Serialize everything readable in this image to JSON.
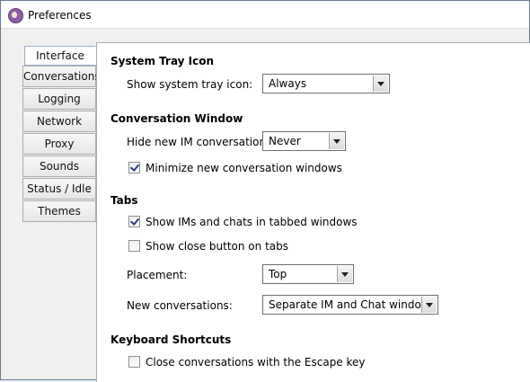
{
  "window": {
    "title": "Preferences"
  },
  "tabs": [
    {
      "label": "Interface",
      "active": true
    },
    {
      "label": "Conversations",
      "active": false
    },
    {
      "label": "Logging",
      "active": false
    },
    {
      "label": "Network",
      "active": false
    },
    {
      "label": "Proxy",
      "active": false
    },
    {
      "label": "Sounds",
      "active": false
    },
    {
      "label": "Status / Idle",
      "active": false
    },
    {
      "label": "Themes",
      "active": false
    }
  ],
  "sections": {
    "tray": {
      "title": "System Tray Icon",
      "show_label": "Show system tray icon:",
      "show_value": "Always"
    },
    "conversation": {
      "title": "Conversation Window",
      "hide_label": "Hide new IM conversations:",
      "hide_value": "Never",
      "minimize_label": "Minimize new conversation windows",
      "minimize_checked": true
    },
    "tabs": {
      "title": "Tabs",
      "tabbed_label": "Show IMs and chats in tabbed windows",
      "tabbed_checked": true,
      "close_label": "Show close button on tabs",
      "close_checked": false,
      "placement_label": "Placement:",
      "placement_value": "Top",
      "newconv_label": "New conversations:",
      "newconv_value": "Separate IM and Chat windows"
    },
    "keyboard": {
      "title": "Keyboard Shortcuts",
      "escape_label": "Close conversations with the Escape key",
      "escape_checked": false
    }
  },
  "colors": {
    "frame": "#6a7b8c",
    "panel": "#ffffff",
    "check": "#2a3b7c"
  }
}
